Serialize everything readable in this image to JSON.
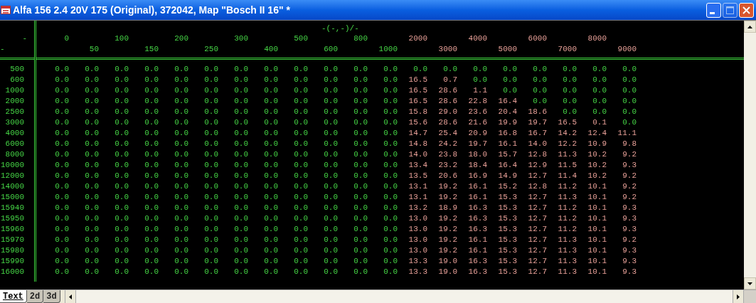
{
  "window": {
    "title": "Alfa 156 2.4 20V 175 (Original), 372042, Map \"Bosch II 16\" *"
  },
  "corner_labels": [
    "-",
    "-"
  ],
  "axis_label": "-(-,-)/-",
  "columns": [
    {
      "label": "0",
      "marked": false
    },
    {
      "label": "50",
      "marked": false
    },
    {
      "label": "100",
      "marked": false
    },
    {
      "label": "150",
      "marked": false
    },
    {
      "label": "200",
      "marked": false
    },
    {
      "label": "250",
      "marked": false
    },
    {
      "label": "300",
      "marked": false
    },
    {
      "label": "400",
      "marked": false
    },
    {
      "label": "500",
      "marked": false
    },
    {
      "label": "600",
      "marked": false
    },
    {
      "label": "800",
      "marked": false
    },
    {
      "label": "1000",
      "marked": false
    },
    {
      "label": "2000",
      "marked": true
    },
    {
      "label": "3000",
      "marked": true
    },
    {
      "label": "4000",
      "marked": true
    },
    {
      "label": "5000",
      "marked": true
    },
    {
      "label": "6000",
      "marked": true
    },
    {
      "label": "7000",
      "marked": true
    },
    {
      "label": "8000",
      "marked": true
    },
    {
      "label": "9000",
      "marked": true
    }
  ],
  "rows": [
    {
      "label": "500",
      "values": [
        "0.0",
        "0.0",
        "0.0",
        "0.0",
        "0.0",
        "0.0",
        "0.0",
        "0.0",
        "0.0",
        "0.0",
        "0.0",
        "0.0",
        "0.0",
        "0.0",
        "0.0",
        "0.0",
        "0.0",
        "0.0",
        "0.0",
        "0.0"
      ],
      "marked": [
        false,
        false,
        false,
        false,
        false,
        false,
        false,
        false,
        false,
        false,
        false,
        false,
        false,
        false,
        false,
        false,
        false,
        false,
        false,
        false
      ]
    },
    {
      "label": "600",
      "values": [
        "0.0",
        "0.0",
        "0.0",
        "0.0",
        "0.0",
        "0.0",
        "0.0",
        "0.0",
        "0.0",
        "0.0",
        "0.0",
        "0.0",
        "16.5",
        "0.7",
        "0.0",
        "0.0",
        "0.0",
        "0.0",
        "0.0",
        "0.0"
      ],
      "marked": [
        false,
        false,
        false,
        false,
        false,
        false,
        false,
        false,
        false,
        false,
        false,
        false,
        true,
        true,
        false,
        false,
        false,
        false,
        false,
        false
      ]
    },
    {
      "label": "1000",
      "values": [
        "0.0",
        "0.0",
        "0.0",
        "0.0",
        "0.0",
        "0.0",
        "0.0",
        "0.0",
        "0.0",
        "0.0",
        "0.0",
        "0.0",
        "16.5",
        "28.6",
        "1.1",
        "0.0",
        "0.0",
        "0.0",
        "0.0",
        "0.0"
      ],
      "marked": [
        false,
        false,
        false,
        false,
        false,
        false,
        false,
        false,
        false,
        false,
        false,
        false,
        true,
        true,
        true,
        false,
        false,
        false,
        false,
        false
      ]
    },
    {
      "label": "2000",
      "values": [
        "0.0",
        "0.0",
        "0.0",
        "0.0",
        "0.0",
        "0.0",
        "0.0",
        "0.0",
        "0.0",
        "0.0",
        "0.0",
        "0.0",
        "16.5",
        "28.6",
        "22.8",
        "16.4",
        "0.0",
        "0.0",
        "0.0",
        "0.0"
      ],
      "marked": [
        false,
        false,
        false,
        false,
        false,
        false,
        false,
        false,
        false,
        false,
        false,
        false,
        true,
        true,
        true,
        true,
        false,
        false,
        false,
        false
      ]
    },
    {
      "label": "2500",
      "values": [
        "0.0",
        "0.0",
        "0.0",
        "0.0",
        "0.0",
        "0.0",
        "0.0",
        "0.0",
        "0.0",
        "0.0",
        "0.0",
        "0.0",
        "15.8",
        "29.0",
        "23.6",
        "20.4",
        "18.6",
        "0.0",
        "0.0",
        "0.0"
      ],
      "marked": [
        false,
        false,
        false,
        false,
        false,
        false,
        false,
        false,
        false,
        false,
        false,
        false,
        true,
        true,
        true,
        true,
        true,
        false,
        false,
        false
      ]
    },
    {
      "label": "3000",
      "values": [
        "0.0",
        "0.0",
        "0.0",
        "0.0",
        "0.0",
        "0.0",
        "0.0",
        "0.0",
        "0.0",
        "0.0",
        "0.0",
        "0.0",
        "15.6",
        "28.6",
        "21.6",
        "19.9",
        "19.7",
        "16.5",
        "0.1",
        "0.0"
      ],
      "marked": [
        false,
        false,
        false,
        false,
        false,
        false,
        false,
        false,
        false,
        false,
        false,
        false,
        true,
        true,
        true,
        true,
        true,
        true,
        true,
        false
      ]
    },
    {
      "label": "4000",
      "values": [
        "0.0",
        "0.0",
        "0.0",
        "0.0",
        "0.0",
        "0.0",
        "0.0",
        "0.0",
        "0.0",
        "0.0",
        "0.0",
        "0.0",
        "14.7",
        "25.4",
        "20.9",
        "16.8",
        "16.7",
        "14.2",
        "12.4",
        "11.1"
      ],
      "marked": [
        false,
        false,
        false,
        false,
        false,
        false,
        false,
        false,
        false,
        false,
        false,
        false,
        true,
        true,
        true,
        true,
        true,
        true,
        true,
        true
      ]
    },
    {
      "label": "6000",
      "values": [
        "0.0",
        "0.0",
        "0.0",
        "0.0",
        "0.0",
        "0.0",
        "0.0",
        "0.0",
        "0.0",
        "0.0",
        "0.0",
        "0.0",
        "14.8",
        "24.2",
        "19.7",
        "16.1",
        "14.0",
        "12.2",
        "10.9",
        "9.8"
      ],
      "marked": [
        false,
        false,
        false,
        false,
        false,
        false,
        false,
        false,
        false,
        false,
        false,
        false,
        true,
        true,
        true,
        true,
        true,
        true,
        true,
        true
      ]
    },
    {
      "label": "8000",
      "values": [
        "0.0",
        "0.0",
        "0.0",
        "0.0",
        "0.0",
        "0.0",
        "0.0",
        "0.0",
        "0.0",
        "0.0",
        "0.0",
        "0.0",
        "14.0",
        "23.8",
        "18.0",
        "15.7",
        "12.8",
        "11.3",
        "10.2",
        "9.2"
      ],
      "marked": [
        false,
        false,
        false,
        false,
        false,
        false,
        false,
        false,
        false,
        false,
        false,
        false,
        true,
        true,
        true,
        true,
        true,
        true,
        true,
        true
      ]
    },
    {
      "label": "10000",
      "values": [
        "0.0",
        "0.0",
        "0.0",
        "0.0",
        "0.0",
        "0.0",
        "0.0",
        "0.0",
        "0.0",
        "0.0",
        "0.0",
        "0.0",
        "13.4",
        "23.2",
        "18.4",
        "16.4",
        "12.9",
        "11.5",
        "10.2",
        "9.3"
      ],
      "marked": [
        false,
        false,
        false,
        false,
        false,
        false,
        false,
        false,
        false,
        false,
        false,
        false,
        true,
        true,
        true,
        true,
        true,
        true,
        true,
        true
      ]
    },
    {
      "label": "12000",
      "values": [
        "0.0",
        "0.0",
        "0.0",
        "0.0",
        "0.0",
        "0.0",
        "0.0",
        "0.0",
        "0.0",
        "0.0",
        "0.0",
        "0.0",
        "13.5",
        "20.6",
        "16.9",
        "14.9",
        "12.7",
        "11.4",
        "10.2",
        "9.2"
      ],
      "marked": [
        false,
        false,
        false,
        false,
        false,
        false,
        false,
        false,
        false,
        false,
        false,
        false,
        true,
        true,
        true,
        true,
        true,
        true,
        true,
        true
      ]
    },
    {
      "label": "14000",
      "values": [
        "0.0",
        "0.0",
        "0.0",
        "0.0",
        "0.0",
        "0.0",
        "0.0",
        "0.0",
        "0.0",
        "0.0",
        "0.0",
        "0.0",
        "13.1",
        "19.2",
        "16.1",
        "15.2",
        "12.8",
        "11.2",
        "10.1",
        "9.2"
      ],
      "marked": [
        false,
        false,
        false,
        false,
        false,
        false,
        false,
        false,
        false,
        false,
        false,
        false,
        true,
        true,
        true,
        true,
        true,
        true,
        true,
        true
      ]
    },
    {
      "label": "15000",
      "values": [
        "0.0",
        "0.0",
        "0.0",
        "0.0",
        "0.0",
        "0.0",
        "0.0",
        "0.0",
        "0.0",
        "0.0",
        "0.0",
        "0.0",
        "13.1",
        "19.2",
        "16.1",
        "15.3",
        "12.7",
        "11.3",
        "10.1",
        "9.2"
      ],
      "marked": [
        false,
        false,
        false,
        false,
        false,
        false,
        false,
        false,
        false,
        false,
        false,
        false,
        true,
        true,
        true,
        true,
        true,
        true,
        true,
        true
      ]
    },
    {
      "label": "15940",
      "values": [
        "0.0",
        "0.0",
        "0.0",
        "0.0",
        "0.0",
        "0.0",
        "0.0",
        "0.0",
        "0.0",
        "0.0",
        "0.0",
        "0.0",
        "13.2",
        "18.9",
        "16.3",
        "15.3",
        "12.7",
        "11.2",
        "10.1",
        "9.3"
      ],
      "marked": [
        false,
        false,
        false,
        false,
        false,
        false,
        false,
        false,
        false,
        false,
        false,
        false,
        true,
        true,
        true,
        true,
        true,
        true,
        true,
        true
      ]
    },
    {
      "label": "15950",
      "values": [
        "0.0",
        "0.0",
        "0.0",
        "0.0",
        "0.0",
        "0.0",
        "0.0",
        "0.0",
        "0.0",
        "0.0",
        "0.0",
        "0.0",
        "13.0",
        "19.2",
        "16.3",
        "15.3",
        "12.7",
        "11.2",
        "10.1",
        "9.3"
      ],
      "marked": [
        false,
        false,
        false,
        false,
        false,
        false,
        false,
        false,
        false,
        false,
        false,
        false,
        true,
        true,
        true,
        true,
        true,
        true,
        true,
        true
      ]
    },
    {
      "label": "15960",
      "values": [
        "0.0",
        "0.0",
        "0.0",
        "0.0",
        "0.0",
        "0.0",
        "0.0",
        "0.0",
        "0.0",
        "0.0",
        "0.0",
        "0.0",
        "13.0",
        "19.2",
        "16.3",
        "15.3",
        "12.7",
        "11.2",
        "10.1",
        "9.3"
      ],
      "marked": [
        false,
        false,
        false,
        false,
        false,
        false,
        false,
        false,
        false,
        false,
        false,
        false,
        true,
        true,
        true,
        true,
        true,
        true,
        true,
        true
      ]
    },
    {
      "label": "15970",
      "values": [
        "0.0",
        "0.0",
        "0.0",
        "0.0",
        "0.0",
        "0.0",
        "0.0",
        "0.0",
        "0.0",
        "0.0",
        "0.0",
        "0.0",
        "13.0",
        "19.2",
        "16.1",
        "15.3",
        "12.7",
        "11.3",
        "10.1",
        "9.2"
      ],
      "marked": [
        false,
        false,
        false,
        false,
        false,
        false,
        false,
        false,
        false,
        false,
        false,
        false,
        true,
        true,
        true,
        true,
        true,
        true,
        true,
        true
      ]
    },
    {
      "label": "15980",
      "values": [
        "0.0",
        "0.0",
        "0.0",
        "0.0",
        "0.0",
        "0.0",
        "0.0",
        "0.0",
        "0.0",
        "0.0",
        "0.0",
        "0.0",
        "13.0",
        "19.2",
        "16.1",
        "15.3",
        "12.7",
        "11.3",
        "10.1",
        "9.3"
      ],
      "marked": [
        false,
        false,
        false,
        false,
        false,
        false,
        false,
        false,
        false,
        false,
        false,
        false,
        true,
        true,
        true,
        true,
        true,
        true,
        true,
        true
      ]
    },
    {
      "label": "15990",
      "values": [
        "0.0",
        "0.0",
        "0.0",
        "0.0",
        "0.0",
        "0.0",
        "0.0",
        "0.0",
        "0.0",
        "0.0",
        "0.0",
        "0.0",
        "13.3",
        "19.0",
        "16.3",
        "15.3",
        "12.7",
        "11.3",
        "10.1",
        "9.3"
      ],
      "marked": [
        false,
        false,
        false,
        false,
        false,
        false,
        false,
        false,
        false,
        false,
        false,
        false,
        true,
        true,
        true,
        true,
        true,
        true,
        true,
        true
      ]
    },
    {
      "label": "16000",
      "values": [
        "0.0",
        "0.0",
        "0.0",
        "0.0",
        "0.0",
        "0.0",
        "0.0",
        "0.0",
        "0.0",
        "0.0",
        "0.0",
        "0.0",
        "13.3",
        "19.0",
        "16.3",
        "15.3",
        "12.7",
        "11.3",
        "10.1",
        "9.3"
      ],
      "marked": [
        false,
        false,
        false,
        false,
        false,
        false,
        false,
        false,
        false,
        false,
        false,
        false,
        true,
        true,
        true,
        true,
        true,
        true,
        true,
        true
      ]
    }
  ],
  "tabs": [
    {
      "label": "Text",
      "selected": true
    },
    {
      "label": "2d",
      "selected": false
    },
    {
      "label": "3d",
      "selected": false
    }
  ]
}
